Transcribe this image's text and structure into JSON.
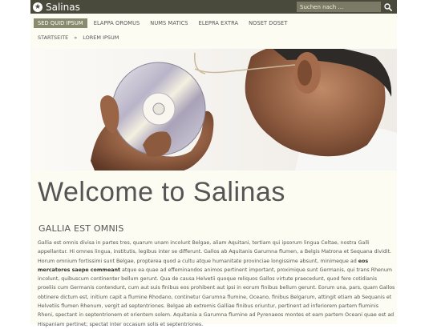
{
  "header": {
    "site_title": "Salinas",
    "search_placeholder": "Suchen nach …",
    "logo_icon": "star-circle-icon",
    "search_icon": "search-icon"
  },
  "nav": {
    "items": [
      {
        "label": "SED QUID IPSUM",
        "active": true
      },
      {
        "label": "ELAPPA OROMUS",
        "active": false
      },
      {
        "label": "NUMS MATICS",
        "active": false
      },
      {
        "label": "ELEPRA EXTRA",
        "active": false
      },
      {
        "label": "NOSET DOSET",
        "active": false
      }
    ]
  },
  "breadcrumb": {
    "home": "STARTSEITE",
    "separator": "»",
    "current": "LOREM IPSUM"
  },
  "main": {
    "heading": "Welcome to Salinas",
    "subheading": "GALLIA EST OMNIS",
    "paragraph_before": "Gallia est omnis divisa in partes tres, quarum unam incolunt Belgae, aliam Aquitani, tertiam qui ipsorum lingua Celtae, nostra Galli appellantur. Hi omnes lingua, institutis, legibus inter se differunt. Gallos ab Aquitanis Garumna flumen, a Belgis Matrona et Sequana dividit. Horum omnium fortissimi sunt Belgae, propterea quod a cultu atque humanitate provinciae longissime absunt, minimeque ad ",
    "paragraph_bold": "eos mercatores saepe commeant",
    "paragraph_after": " atque ea quae ad effeminandos animos pertinent important, proximique sunt Germanis, qui trans Rhenum incolunt, quibuscum continenter bellum gerunt. Qua de causa Helvetii quoque reliquos Gallos virtute praecedunt, quod fere cotidianis proeliis cum Germanis contendunt, cum aut suis finibus eos prohibent aut ipsi in eorum finibus bellum gerunt. Eorum una, pars, quam Gallos obtinere dictum est, initium capit a flumine Rhodano, continetur Garumna flumine, Oceano, finibus Belgarum, attingit etiam ab Sequanis et Helvetiis flumen Rhenum, vergit ad septentriones. Belgae ab extremis Galliae finibus oriuntur, pertinent ad inferiorem partem fluminis Rheni, spectant in septentrionem et orientem solem. Aquitania a Garumna flumine ad Pyrenaeos montes et eam partem Oceani quae est ad Hispaniam pertinet; spectat inter occasum solis et septentriones."
  },
  "colors": {
    "topbar": "#4a4a3c",
    "nav_active": "#8a8a6e",
    "page_bg": "#fdfcf2"
  }
}
